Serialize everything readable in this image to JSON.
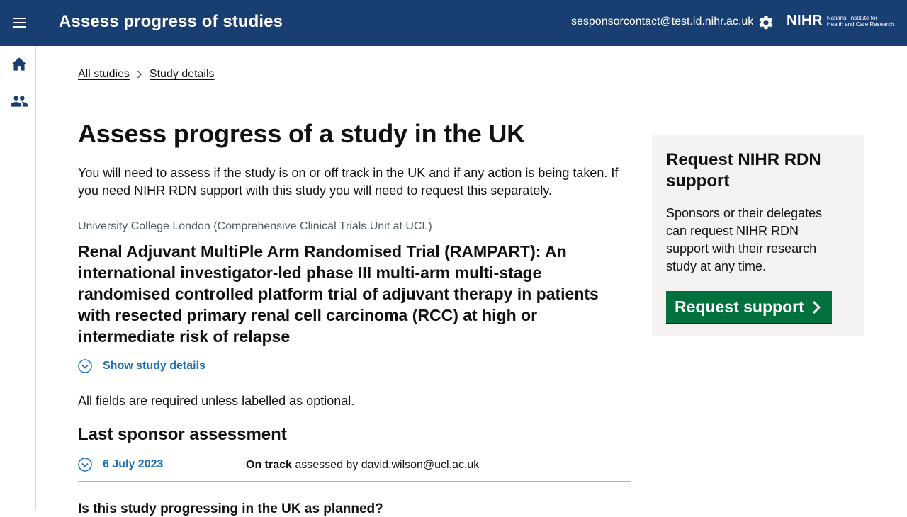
{
  "header": {
    "app_title": "Assess progress of studies",
    "user_email": "sesponsorcontact@test.id.nihr.ac.uk",
    "logo_text": "NIHR",
    "logo_subtitle_line1": "National Institute for",
    "logo_subtitle_line2": "Health and Care Research",
    "menu_icon": "menu-icon",
    "settings_icon": "gear-icon",
    "background_color": "#193e72"
  },
  "sidebar": {
    "items": [
      {
        "icon": "home-icon"
      },
      {
        "icon": "people-icon"
      }
    ]
  },
  "breadcrumb": {
    "items": [
      "All studies",
      "Study details"
    ]
  },
  "main": {
    "heading": "Assess progress of a study in the UK",
    "intro": "You will need to assess if the study is on or off track in the UK and if any action is being taken. If you need NIHR RDN support with this study you will need to request this separately.",
    "organisation": "University College London (Comprehensive Clinical Trials Unit at UCL)",
    "study_title": "Renal Adjuvant MultiPle Arm Randomised Trial (RAMPART): An international investigator-led phase III multi-arm multi-stage randomised controlled platform trial of adjuvant therapy in patients with resected primary renal cell carcinoma (RCC) at high or intermediate risk of relapse",
    "show_details_label": "Show study details",
    "required_note": "All fields are required unless labelled as optional.",
    "last_assessment_heading": "Last sponsor assessment",
    "last_assessment": {
      "date": "6 July 2023",
      "status": "On track",
      "assessed_by": "assessed by david.wilson@ucl.ac.uk"
    },
    "next_question": "Is this study progressing in the UK as planned?"
  },
  "aside": {
    "title": "Request NIHR RDN support",
    "body": "Sponsors or their delegates can request NIHR RDN support with their research study at any time.",
    "button_label": "Request support",
    "button_color": "#00703c"
  },
  "colors": {
    "link": "#1d70b8",
    "aside_background": "#f3f2f1"
  }
}
